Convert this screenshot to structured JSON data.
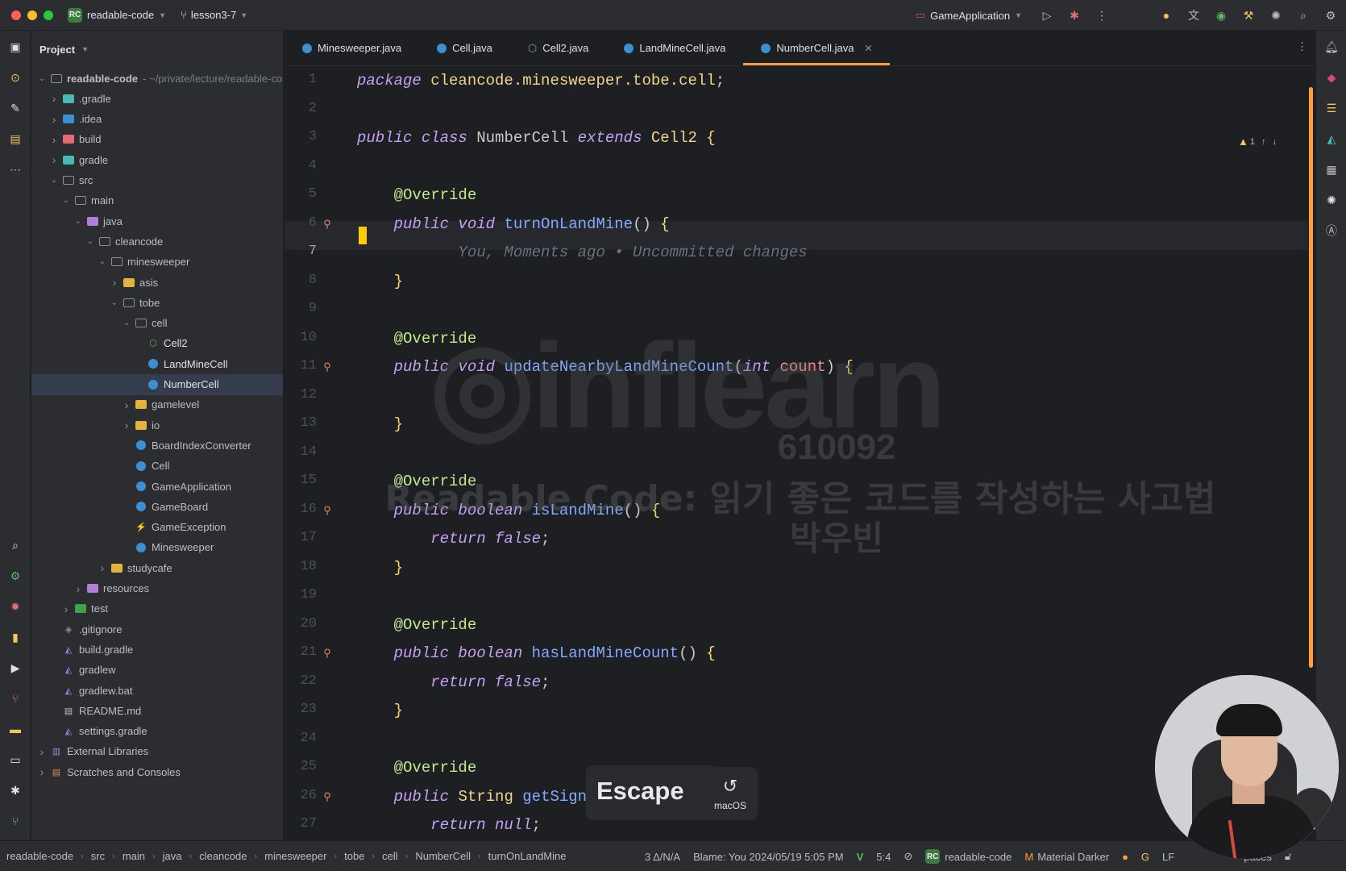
{
  "titlebar": {
    "project_badge": "RC",
    "project": "readable-code",
    "branch": "lesson3-7",
    "run_config": "GameApplication"
  },
  "project_panel": {
    "title": "Project",
    "tree": [
      {
        "label": "readable-code",
        "suffix": "~/private/lecture/readable-co",
        "depth": 0,
        "open": true,
        "kind": "root"
      },
      {
        "label": ".gradle",
        "depth": 1,
        "open": false,
        "kind": "folder-teal"
      },
      {
        "label": ".idea",
        "depth": 1,
        "open": false,
        "kind": "folder-blue"
      },
      {
        "label": "build",
        "depth": 1,
        "open": false,
        "kind": "folder-red"
      },
      {
        "label": "gradle",
        "depth": 1,
        "open": false,
        "kind": "folder-teal"
      },
      {
        "label": "src",
        "depth": 1,
        "open": true,
        "kind": "folder-plain"
      },
      {
        "label": "main",
        "depth": 2,
        "open": true,
        "kind": "folder-plain"
      },
      {
        "label": "java",
        "depth": 3,
        "open": true,
        "kind": "folder-purple"
      },
      {
        "label": "cleancode",
        "depth": 4,
        "open": true,
        "kind": "folder-plain"
      },
      {
        "label": "minesweeper",
        "depth": 5,
        "open": true,
        "kind": "folder-plain"
      },
      {
        "label": "asis",
        "depth": 6,
        "open": false,
        "kind": "folder-yellow"
      },
      {
        "label": "tobe",
        "depth": 6,
        "open": true,
        "kind": "folder-plain"
      },
      {
        "label": "cell",
        "depth": 7,
        "open": true,
        "kind": "folder-plain"
      },
      {
        "label": "Cell2",
        "depth": 8,
        "kind": "interface",
        "accent": true
      },
      {
        "label": "LandMineCell",
        "depth": 8,
        "kind": "class",
        "accent": true
      },
      {
        "label": "NumberCell",
        "depth": 8,
        "kind": "class",
        "accent": true,
        "current": true
      },
      {
        "label": "gamelevel",
        "depth": 7,
        "open": false,
        "kind": "folder-yellow"
      },
      {
        "label": "io",
        "depth": 7,
        "open": false,
        "kind": "folder-yellow"
      },
      {
        "label": "BoardIndexConverter",
        "depth": 7,
        "kind": "class"
      },
      {
        "label": "Cell",
        "depth": 7,
        "kind": "class"
      },
      {
        "label": "GameApplication",
        "depth": 7,
        "kind": "class"
      },
      {
        "label": "GameBoard",
        "depth": 7,
        "kind": "class"
      },
      {
        "label": "GameException",
        "depth": 7,
        "kind": "exception"
      },
      {
        "label": "Minesweeper",
        "depth": 7,
        "kind": "class"
      },
      {
        "label": "studycafe",
        "depth": 5,
        "open": false,
        "kind": "folder-yellow"
      },
      {
        "label": "resources",
        "depth": 3,
        "open": false,
        "kind": "folder-purple"
      },
      {
        "label": "test",
        "depth": 2,
        "open": false,
        "kind": "folder-green"
      },
      {
        "label": ".gitignore",
        "depth": 1,
        "kind": "gitignore"
      },
      {
        "label": "build.gradle",
        "depth": 1,
        "kind": "gradle"
      },
      {
        "label": "gradlew",
        "depth": 1,
        "kind": "gradle"
      },
      {
        "label": "gradlew.bat",
        "depth": 1,
        "kind": "gradle"
      },
      {
        "label": "README.md",
        "depth": 1,
        "kind": "md"
      },
      {
        "label": "settings.gradle",
        "depth": 1,
        "kind": "gradle"
      },
      {
        "label": "External Libraries",
        "depth": 0,
        "open": false,
        "kind": "lib"
      },
      {
        "label": "Scratches and Consoles",
        "depth": 0,
        "open": false,
        "kind": "scratch"
      }
    ]
  },
  "tabs": [
    {
      "label": "Minesweeper.java",
      "kind": "class"
    },
    {
      "label": "Cell.java",
      "kind": "class"
    },
    {
      "label": "Cell2.java",
      "kind": "interface"
    },
    {
      "label": "LandMineCell.java",
      "kind": "class"
    },
    {
      "label": "NumberCell.java",
      "kind": "class",
      "active": true
    }
  ],
  "editor": {
    "inspection_count": "1",
    "current_line": 7,
    "lines": [
      {
        "n": "1",
        "segs": [
          [
            "kw",
            "package "
          ],
          [
            "ty",
            "cleancode.minesweeper.tobe.cell"
          ],
          [
            "",
            "; "
          ]
        ]
      },
      {
        "n": "2",
        "segs": []
      },
      {
        "n": "3",
        "segs": [
          [
            "kw",
            "public class "
          ],
          [
            "",
            "NumberCell "
          ],
          [
            "kw",
            "extends "
          ],
          [
            "ty",
            "Cell2 "
          ],
          [
            "br",
            "{"
          ]
        ]
      },
      {
        "n": "4",
        "segs": []
      },
      {
        "n": "5",
        "segs": [
          [
            "",
            "    "
          ],
          [
            "an",
            "@Override"
          ]
        ]
      },
      {
        "n": "6",
        "gut": true,
        "segs": [
          [
            "",
            "    "
          ],
          [
            "kw",
            "public void "
          ],
          [
            "fn",
            "turnOnLandMine"
          ],
          [
            "",
            "() "
          ],
          [
            "br",
            "{"
          ]
        ]
      },
      {
        "n": "7",
        "segs": [
          [
            "",
            "           "
          ],
          [
            "cm",
            "You, Moments ago • Uncommitted changes"
          ]
        ]
      },
      {
        "n": "8",
        "segs": [
          [
            "",
            "    "
          ],
          [
            "br",
            "}"
          ]
        ]
      },
      {
        "n": "9",
        "segs": []
      },
      {
        "n": "10",
        "segs": [
          [
            "",
            "    "
          ],
          [
            "an",
            "@Override"
          ]
        ]
      },
      {
        "n": "11",
        "gut": true,
        "segs": [
          [
            "",
            "    "
          ],
          [
            "kw",
            "public void "
          ],
          [
            "fn",
            "updateNearbyLandMineCount"
          ],
          [
            "",
            "("
          ],
          [
            "kw",
            "int "
          ],
          [
            "pm",
            "count"
          ],
          [
            "",
            ") "
          ],
          [
            "br",
            "{"
          ]
        ]
      },
      {
        "n": "12",
        "segs": []
      },
      {
        "n": "13",
        "segs": [
          [
            "",
            "    "
          ],
          [
            "br",
            "}"
          ]
        ]
      },
      {
        "n": "14",
        "segs": []
      },
      {
        "n": "15",
        "segs": [
          [
            "",
            "    "
          ],
          [
            "an",
            "@Override"
          ]
        ]
      },
      {
        "n": "16",
        "gut": true,
        "segs": [
          [
            "",
            "    "
          ],
          [
            "kw",
            "public boolean "
          ],
          [
            "fn",
            "isLandMine"
          ],
          [
            "",
            "() "
          ],
          [
            "br",
            "{"
          ]
        ]
      },
      {
        "n": "17",
        "segs": [
          [
            "",
            "        "
          ],
          [
            "kw",
            "return false"
          ],
          [
            "",
            ";"
          ]
        ]
      },
      {
        "n": "18",
        "segs": [
          [
            "",
            "    "
          ],
          [
            "br",
            "}"
          ]
        ]
      },
      {
        "n": "19",
        "segs": []
      },
      {
        "n": "20",
        "segs": [
          [
            "",
            "    "
          ],
          [
            "an",
            "@Override"
          ]
        ]
      },
      {
        "n": "21",
        "gut": true,
        "segs": [
          [
            "",
            "    "
          ],
          [
            "kw",
            "public boolean "
          ],
          [
            "fn",
            "hasLandMineCount"
          ],
          [
            "",
            "() "
          ],
          [
            "br",
            "{"
          ]
        ]
      },
      {
        "n": "22",
        "segs": [
          [
            "",
            "        "
          ],
          [
            "kw",
            "return false"
          ],
          [
            "",
            ";"
          ]
        ]
      },
      {
        "n": "23",
        "segs": [
          [
            "",
            "    "
          ],
          [
            "br",
            "}"
          ]
        ]
      },
      {
        "n": "24",
        "segs": []
      },
      {
        "n": "25",
        "segs": [
          [
            "",
            "    "
          ],
          [
            "an",
            "@Override"
          ]
        ]
      },
      {
        "n": "26",
        "gut": true,
        "segs": [
          [
            "",
            "    "
          ],
          [
            "kw",
            "public "
          ],
          [
            "ty",
            "String "
          ],
          [
            "fn",
            "getSign"
          ],
          [
            "",
            "()"
          ]
        ]
      },
      {
        "n": "27",
        "segs": [
          [
            "",
            "        "
          ],
          [
            "kw",
            "return null"
          ],
          [
            "",
            ";"
          ]
        ]
      }
    ]
  },
  "watermark": {
    "logo": "inflearn",
    "number": "610092",
    "course": "Readable Code: 읽기 좋은 코드를 작성하는 사고법",
    "author": "박우빈"
  },
  "key_overlay": {
    "key": "Escape",
    "os": "macOS"
  },
  "statusbar": {
    "breadcrumb": [
      "readable-code",
      "src",
      "main",
      "java",
      "cleancode",
      "minesweeper",
      "tobe",
      "cell",
      "NumberCell",
      "turnOnLandMine"
    ],
    "vcs": "3 Δ/N/A",
    "blame": "Blame: You 2024/05/19 5:05 PM",
    "position": "5:4",
    "project_badge": "RC",
    "project": "readable-code",
    "theme": "Material Darker",
    "line_sep": "LF",
    "indent": "paces"
  }
}
